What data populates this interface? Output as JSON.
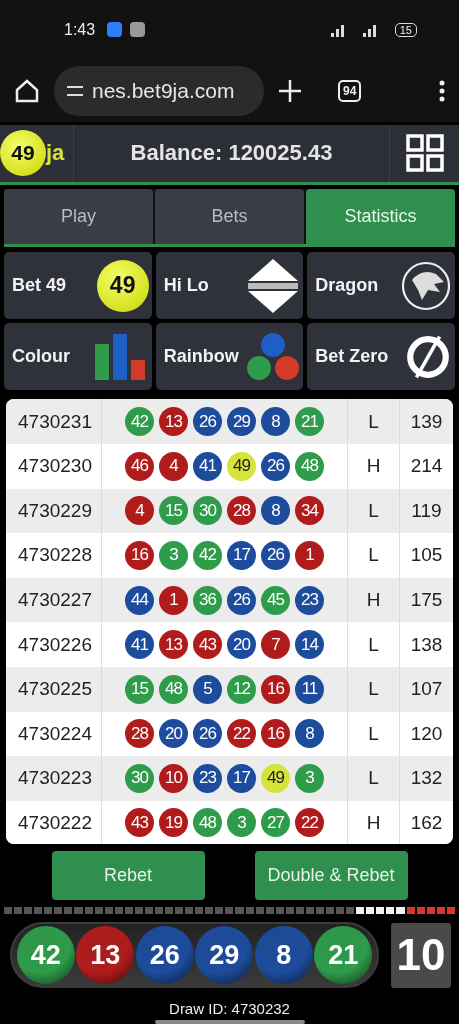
{
  "status_bar": {
    "time": "1:43",
    "battery": "15"
  },
  "browser": {
    "url": "nes.bet9ja.com",
    "tab_count": "94"
  },
  "header": {
    "logo": {
      "number": "49",
      "suffix": "ja"
    },
    "balance": "Balance: 120025.43"
  },
  "tabs": [
    {
      "label": "Play",
      "selected": false
    },
    {
      "label": "Bets",
      "selected": false
    },
    {
      "label": "Statistics",
      "selected": true
    }
  ],
  "games": [
    {
      "label": "Bet 49",
      "kind": "ball49",
      "icon_text": "49"
    },
    {
      "label": "Hi Lo",
      "kind": "hilo"
    },
    {
      "label": "Dragon",
      "kind": "dragon"
    },
    {
      "label": "Colour",
      "kind": "bars"
    },
    {
      "label": "Rainbow",
      "kind": "dots"
    },
    {
      "label": "Bet Zero",
      "kind": "zero"
    }
  ],
  "results": [
    {
      "draw": "4730231",
      "balls": [
        {
          "n": "42",
          "color": "#2e9c4a"
        },
        {
          "n": "13",
          "color": "#b01c1c"
        },
        {
          "n": "26",
          "color": "#1d4c9c"
        },
        {
          "n": "29",
          "color": "#1d4c9c"
        },
        {
          "n": "8",
          "color": "#1d4c9c"
        },
        {
          "n": "21",
          "color": "#2e9c4a"
        }
      ],
      "hilo": "L",
      "sum": "139"
    },
    {
      "draw": "4730230",
      "balls": [
        {
          "n": "46",
          "color": "#b01c1c"
        },
        {
          "n": "4",
          "color": "#b01c1c"
        },
        {
          "n": "41",
          "color": "#1d4c9c"
        },
        {
          "n": "49",
          "color": "#d6e33a"
        },
        {
          "n": "26",
          "color": "#1d4c9c"
        },
        {
          "n": "48",
          "color": "#2e9c4a"
        }
      ],
      "hilo": "H",
      "sum": "214"
    },
    {
      "draw": "4730229",
      "balls": [
        {
          "n": "4",
          "color": "#b01c1c"
        },
        {
          "n": "15",
          "color": "#2e9c4a"
        },
        {
          "n": "30",
          "color": "#2e9c4a"
        },
        {
          "n": "28",
          "color": "#b01c1c"
        },
        {
          "n": "8",
          "color": "#1d4c9c"
        },
        {
          "n": "34",
          "color": "#b01c1c"
        }
      ],
      "hilo": "L",
      "sum": "119"
    },
    {
      "draw": "4730228",
      "balls": [
        {
          "n": "16",
          "color": "#b01c1c"
        },
        {
          "n": "3",
          "color": "#2e9c4a"
        },
        {
          "n": "42",
          "color": "#2e9c4a"
        },
        {
          "n": "17",
          "color": "#1d4c9c"
        },
        {
          "n": "26",
          "color": "#1d4c9c"
        },
        {
          "n": "1",
          "color": "#b01c1c"
        }
      ],
      "hilo": "L",
      "sum": "105"
    },
    {
      "draw": "4730227",
      "balls": [
        {
          "n": "44",
          "color": "#1d4c9c"
        },
        {
          "n": "1",
          "color": "#b01c1c"
        },
        {
          "n": "36",
          "color": "#2e9c4a"
        },
        {
          "n": "26",
          "color": "#1d4c9c"
        },
        {
          "n": "45",
          "color": "#2e9c4a"
        },
        {
          "n": "23",
          "color": "#1d4c9c"
        }
      ],
      "hilo": "H",
      "sum": "175"
    },
    {
      "draw": "4730226",
      "balls": [
        {
          "n": "41",
          "color": "#1d4c9c"
        },
        {
          "n": "13",
          "color": "#b01c1c"
        },
        {
          "n": "43",
          "color": "#b01c1c"
        },
        {
          "n": "20",
          "color": "#1d4c9c"
        },
        {
          "n": "7",
          "color": "#b01c1c"
        },
        {
          "n": "14",
          "color": "#1d4c9c"
        }
      ],
      "hilo": "L",
      "sum": "138"
    },
    {
      "draw": "4730225",
      "balls": [
        {
          "n": "15",
          "color": "#2e9c4a"
        },
        {
          "n": "48",
          "color": "#2e9c4a"
        },
        {
          "n": "5",
          "color": "#1d4c9c"
        },
        {
          "n": "12",
          "color": "#2e9c4a"
        },
        {
          "n": "16",
          "color": "#b01c1c"
        },
        {
          "n": "11",
          "color": "#1d4c9c"
        }
      ],
      "hilo": "L",
      "sum": "107"
    },
    {
      "draw": "4730224",
      "balls": [
        {
          "n": "28",
          "color": "#b01c1c"
        },
        {
          "n": "20",
          "color": "#1d4c9c"
        },
        {
          "n": "26",
          "color": "#1d4c9c"
        },
        {
          "n": "22",
          "color": "#b01c1c"
        },
        {
          "n": "16",
          "color": "#b01c1c"
        },
        {
          "n": "8",
          "color": "#1d4c9c"
        }
      ],
      "hilo": "L",
      "sum": "120"
    },
    {
      "draw": "4730223",
      "balls": [
        {
          "n": "30",
          "color": "#2e9c4a"
        },
        {
          "n": "10",
          "color": "#b01c1c"
        },
        {
          "n": "23",
          "color": "#1d4c9c"
        },
        {
          "n": "17",
          "color": "#1d4c9c"
        },
        {
          "n": "49",
          "color": "#d6e33a"
        },
        {
          "n": "3",
          "color": "#2e9c4a"
        }
      ],
      "hilo": "L",
      "sum": "132"
    },
    {
      "draw": "4730222",
      "balls": [
        {
          "n": "43",
          "color": "#b01c1c"
        },
        {
          "n": "19",
          "color": "#b01c1c"
        },
        {
          "n": "48",
          "color": "#2e9c4a"
        },
        {
          "n": "3",
          "color": "#2e9c4a"
        },
        {
          "n": "27",
          "color": "#2e9c4a"
        },
        {
          "n": "22",
          "color": "#b01c1c"
        }
      ],
      "hilo": "H",
      "sum": "162"
    }
  ],
  "actions": [
    "Rebet",
    "Double & Rebet"
  ],
  "current_draw": {
    "balls": [
      {
        "n": "42",
        "color": "#2e9c4a"
      },
      {
        "n": "13",
        "color": "#b01c1c"
      },
      {
        "n": "26",
        "color": "#1d4c9c"
      },
      {
        "n": "29",
        "color": "#1d4c9c"
      },
      {
        "n": "8",
        "color": "#1d4c9c"
      },
      {
        "n": "21",
        "color": "#2e9c4a"
      }
    ],
    "timer": "10",
    "draw_id": "Draw ID: 4730232"
  }
}
